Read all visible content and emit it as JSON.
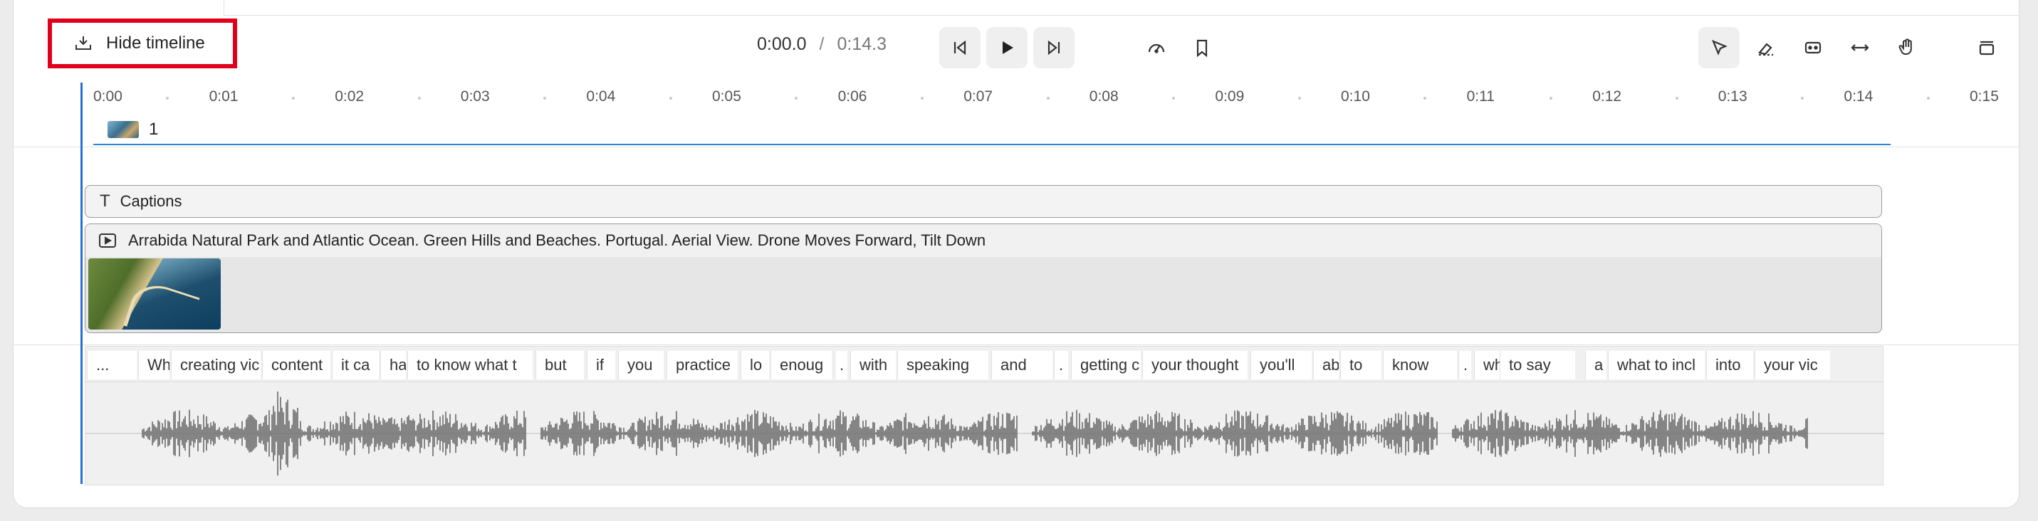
{
  "toolbar": {
    "hide_timeline_label": "Hide timeline",
    "current_time": "0:00.0",
    "separator": "/",
    "duration": "0:14.3",
    "icons": [
      "skip-back-icon",
      "play-icon",
      "skip-forward-icon",
      "speed-icon",
      "bookmark-icon",
      "pointer-icon",
      "eraser-icon",
      "split-icon",
      "resize-horizontal-icon",
      "hand-icon",
      "panel-icon"
    ]
  },
  "ruler": {
    "ticks": [
      "0:00",
      "0:01",
      "0:02",
      "0:03",
      "0:04",
      "0:05",
      "0:06",
      "0:07",
      "0:08",
      "0:09",
      "0:10",
      "0:11",
      "0:12",
      "0:13",
      "0:14",
      "0:15"
    ]
  },
  "scene": {
    "number": "1"
  },
  "tracks": {
    "captions_label": "Captions",
    "video_title": "Arrabida Natural Park and Atlantic Ocean. Green Hills and Beaches. Portugal. Aerial View. Drone Moves Forward, Tilt Down"
  },
  "words": [
    "...",
    "Wh",
    "creating vic",
    "content",
    "it ca",
    "ha",
    "to know what t",
    "but",
    "if",
    "you",
    "practice",
    "lo",
    "enoug",
    ".",
    "with",
    "speaking",
    "and",
    ".",
    "getting c",
    "your thought",
    "you'll",
    "ab",
    "to",
    "know",
    ".",
    "wha",
    "to say",
    "a",
    "what to incl",
    "into",
    "your vic"
  ],
  "colors": {
    "highlight": "#e0001b",
    "playhead": "#2a6fd6",
    "waveform": "#6a6a6a"
  }
}
